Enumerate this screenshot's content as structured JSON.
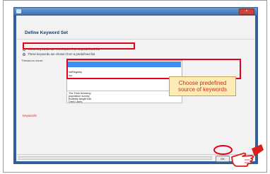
{
  "window": {
    "title": "",
    "close_label": "×",
    "heading": "Define Keyword Set"
  },
  "radios": [
    {
      "label": "These keywords are not chosen from a predefined list",
      "checked": false
    },
    {
      "label": "These keywords are chosen from a predefined list",
      "checked": true
    }
  ],
  "thesaurus": {
    "label": "Thesaurus name:",
    "selected": "",
    "items": [
      "IntlRegistry",
      "iso"
    ]
  },
  "list2": {
    "items": [
      "The Frick Amazing",
      "population survey",
      "Butterfly tangle folk",
      "Dred Lakes"
    ]
  },
  "keywords": {
    "label": "Keywords"
  },
  "side_button": {
    "label": "Create"
  },
  "buttons": {
    "ok": "OK",
    "cancel": "Cancel"
  },
  "callout": {
    "line1": "Choose predefined",
    "line2": "source of keywords"
  },
  "colors": {
    "highlight": "#e3001b",
    "callout_bg": "#fcebb6",
    "callout_text": "#c83218",
    "selection": "#3c8ef0"
  }
}
